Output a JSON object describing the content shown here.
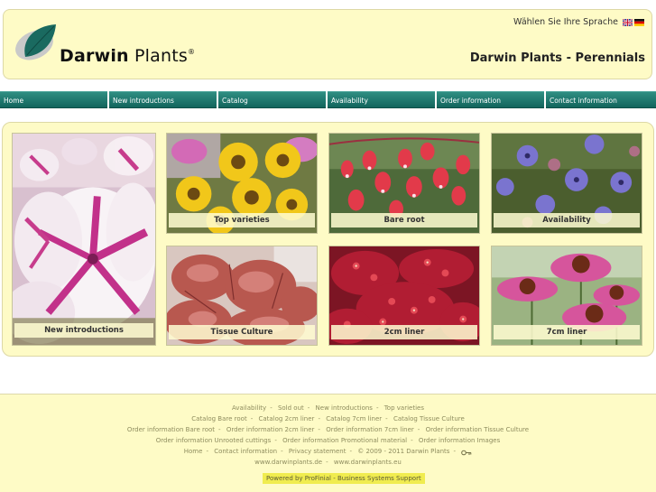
{
  "header": {
    "logo_brand": "Darwin",
    "logo_name": "Plants",
    "logo_mark": "®",
    "language_prompt": "Wählen Sie Ihre Sprache",
    "page_title": "Darwin Plants - Perennials",
    "flags": [
      "uk-flag-icon",
      "german-flag-icon"
    ]
  },
  "nav": {
    "items": [
      {
        "label": "Home"
      },
      {
        "label": "New introductions"
      },
      {
        "label": "Catalog"
      },
      {
        "label": "Availability"
      },
      {
        "label": "Order information"
      },
      {
        "label": "Contact information"
      }
    ]
  },
  "tiles": [
    {
      "caption": "New introductions",
      "image": "striped-petunia-photo"
    },
    {
      "caption": "Top varieties",
      "image": "yellow-echinacea-photo"
    },
    {
      "caption": "Bare root",
      "image": "bleeding-heart-photo"
    },
    {
      "caption": "Availability",
      "image": "blue-geranium-photo"
    },
    {
      "caption": "Tissue Culture",
      "image": "heuchera-photo"
    },
    {
      "caption": "2cm liner",
      "image": "red-achillea-photo"
    },
    {
      "caption": "7cm liner",
      "image": "pink-echinacea-photo"
    }
  ],
  "footer": {
    "line1": [
      "Availability",
      "Sold out",
      "New introductions",
      "Top varieties"
    ],
    "line2": [
      "Catalog Bare root",
      "Catalog 2cm liner",
      "Catalog 7cm liner",
      "Catalog Tissue Culture"
    ],
    "line3": [
      "Order information Bare root",
      "Order information 2cm liner",
      "Order information 7cm liner",
      "Order information Tissue Culture"
    ],
    "line4": [
      "Order information Unrooted cuttings",
      "Order information Promotional material",
      "Order information Images"
    ],
    "line5": [
      "Home",
      "Contact information",
      "Privacy statement"
    ],
    "copyright": "© 2009 - 2011 Darwin Plants",
    "line6": [
      "www.darwinplants.de",
      "www.darwinplants.eu"
    ],
    "powered_by": "Powered by ProFinial - Business Systems Support"
  },
  "colors": {
    "header_bg": "#fefbc6",
    "nav_teal": "#1a7369",
    "powered_bg": "#f0ec4f"
  }
}
